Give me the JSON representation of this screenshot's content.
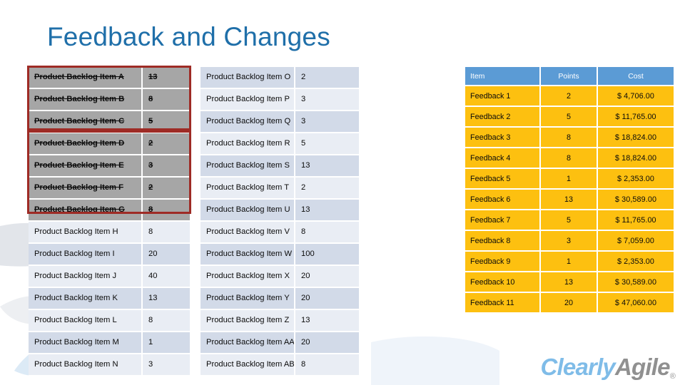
{
  "slide": {
    "title": "Feedback and Changes",
    "title_color": "#1F6FA9",
    "background": "#FFFFFF"
  },
  "logo": {
    "part_one": "Clearly",
    "part_two": "Agile",
    "registered_mark": "®",
    "part_one_color": "#7FBCE8",
    "part_two_color": "#909090"
  },
  "highlight_boxes": {
    "color": "#9E2B25",
    "count": 2,
    "note": "two red outline boxes around removed backlog rows"
  },
  "backlog_table_1": {
    "row_band_colors": [
      "#D2DAE8",
      "#E9EDF4"
    ],
    "removed_row_color": "#A6A6A6",
    "rows": [
      {
        "name": "Product Backlog Item A",
        "points": "13",
        "removed": true
      },
      {
        "name": "Product Backlog Item B",
        "points": "8",
        "removed": true
      },
      {
        "name": "Product Backlog Item C",
        "points": "5",
        "removed": true
      },
      {
        "name": "Product Backlog Item D",
        "points": "2",
        "removed": true
      },
      {
        "name": "Product Backlog Item E",
        "points": "3",
        "removed": true
      },
      {
        "name": "Product Backlog Item F",
        "points": "2",
        "removed": true
      },
      {
        "name": "Product Backlog Item G",
        "points": "8",
        "removed": true
      },
      {
        "name": "Product Backlog Item H",
        "points": "8",
        "removed": false
      },
      {
        "name": "Product Backlog Item I",
        "points": "20",
        "removed": false
      },
      {
        "name": "Product Backlog Item J",
        "points": "40",
        "removed": false
      },
      {
        "name": "Product Backlog Item K",
        "points": "13",
        "removed": false
      },
      {
        "name": "Product Backlog Item L",
        "points": "8",
        "removed": false
      },
      {
        "name": "Product Backlog Item M",
        "points": "1",
        "removed": false
      },
      {
        "name": "Product Backlog Item N",
        "points": "3",
        "removed": false
      }
    ]
  },
  "backlog_table_2": {
    "rows": [
      {
        "name": "Product Backlog Item O",
        "points": "2"
      },
      {
        "name": "Product Backlog Item P",
        "points": "3"
      },
      {
        "name": "Product Backlog Item Q",
        "points": "3"
      },
      {
        "name": "Product Backlog Item R",
        "points": "5"
      },
      {
        "name": "Product Backlog Item S",
        "points": "13"
      },
      {
        "name": "Product Backlog Item T",
        "points": "2"
      },
      {
        "name": "Product Backlog Item U",
        "points": "13"
      },
      {
        "name": "Product Backlog Item V",
        "points": "8"
      },
      {
        "name": "Product Backlog Item W",
        "points": "100"
      },
      {
        "name": "Product Backlog Item X",
        "points": "20"
      },
      {
        "name": "Product Backlog Item Y",
        "points": "20"
      },
      {
        "name": "Product Backlog Item Z",
        "points": "13"
      },
      {
        "name": "Product Backlog Item AA",
        "points": "20"
      },
      {
        "name": "Product Backlog Item AB",
        "points": "8"
      }
    ]
  },
  "feedback_table": {
    "header_color": "#5B9BD5",
    "row_color": "#FDC010",
    "headers": {
      "item": "Item",
      "points": "Points",
      "cost": "Cost"
    },
    "rows": [
      {
        "item": "Feedback 1",
        "points": "2",
        "cost": "$   4,706.00"
      },
      {
        "item": "Feedback 2",
        "points": "5",
        "cost": "$  11,765.00"
      },
      {
        "item": "Feedback 3",
        "points": "8",
        "cost": "$  18,824.00"
      },
      {
        "item": "Feedback 4",
        "points": "8",
        "cost": "$  18,824.00"
      },
      {
        "item": "Feedback 5",
        "points": "1",
        "cost": "$   2,353.00"
      },
      {
        "item": "Feedback 6",
        "points": "13",
        "cost": "$  30,589.00"
      },
      {
        "item": "Feedback 7",
        "points": "5",
        "cost": "$  11,765.00"
      },
      {
        "item": "Feedback 8",
        "points": "3",
        "cost": "$   7,059.00"
      },
      {
        "item": "Feedback 9",
        "points": "1",
        "cost": "$   2,353.00"
      },
      {
        "item": "Feedback 10",
        "points": "13",
        "cost": "$  30,589.00"
      },
      {
        "item": "Feedback 11",
        "points": "20",
        "cost": "$  47,060.00"
      }
    ]
  }
}
